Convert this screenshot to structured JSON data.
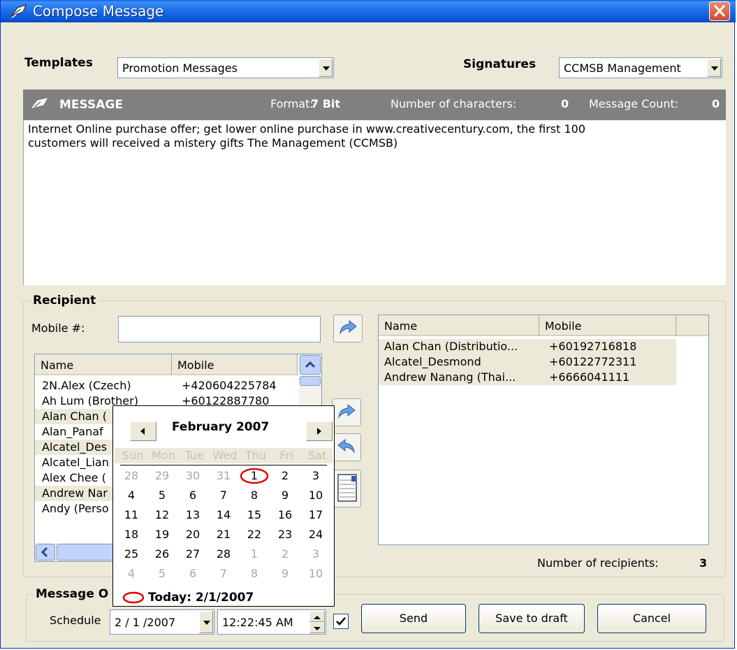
{
  "window": {
    "title": "Compose Message"
  },
  "templates": {
    "label": "Templates",
    "value": "Promotion Messages"
  },
  "signatures": {
    "label": "Signatures",
    "value": "CCMSB Management"
  },
  "message": {
    "header_label": "MESSAGE",
    "format_label": "Format:",
    "format_value": "7 Bit",
    "chars_label": "Number of characters:",
    "chars_value": "0",
    "count_label": "Message Count:",
    "count_value": "0",
    "body_line1": "Internet Online purchase offer; get lower online purchase in www.creativecentury.com, the first 100",
    "body_line2": "customers will received a mistery gifts The Management (CCMSB)"
  },
  "recipient": {
    "group_label": "Recipient",
    "mobile_label": "Mobile #:",
    "mobile_value": "",
    "contacts_headers": [
      "Name",
      "Mobile"
    ],
    "contacts": [
      {
        "name": "2N.Alex (Czech)",
        "mobile": "+420604225784"
      },
      {
        "name": "Ah Lum (Brother)",
        "mobile": "+60122887780"
      },
      {
        "name": "Alan Chan (",
        "mobile": ""
      },
      {
        "name": "Alan_Panaf",
        "mobile": ""
      },
      {
        "name": "Alcatel_Des",
        "mobile": ""
      },
      {
        "name": "Alcatel_Lian",
        "mobile": ""
      },
      {
        "name": "Alex Chee (",
        "mobile": ""
      },
      {
        "name": "Andrew Nar",
        "mobile": ""
      },
      {
        "name": "Andy (Perso",
        "mobile": ""
      }
    ],
    "selected_headers": [
      "Name",
      "Mobile"
    ],
    "selected": [
      {
        "name": "Alan Chan (Distributio...",
        "mobile": "+60192716818"
      },
      {
        "name": "Alcatel_Desmond",
        "mobile": "+60122772311"
      },
      {
        "name": "Andrew Nanang (Thai...",
        "mobile": "+6666041111"
      }
    ],
    "count_label": "Number of recipients:",
    "count_value": "3"
  },
  "calendar": {
    "month_label": "February 2007",
    "day_names": [
      "Sun",
      "Mon",
      "Tue",
      "Wed",
      "Thu",
      "Fri",
      "Sat"
    ],
    "weeks": [
      [
        "28",
        "29",
        "30",
        "31",
        "1",
        "2",
        "3"
      ],
      [
        "4",
        "5",
        "6",
        "7",
        "8",
        "9",
        "10"
      ],
      [
        "11",
        "12",
        "13",
        "14",
        "15",
        "16",
        "17"
      ],
      [
        "18",
        "19",
        "20",
        "21",
        "22",
        "23",
        "24"
      ],
      [
        "25",
        "26",
        "27",
        "28",
        "1",
        "2",
        "3"
      ],
      [
        "4",
        "5",
        "6",
        "7",
        "8",
        "9",
        "10"
      ]
    ],
    "today_label": "Today: 2/1/2007"
  },
  "options": {
    "group_label": "Message O",
    "schedule_label": "Schedule",
    "date_value": "2 / 1 /2007",
    "time_value": "12:22:45 AM",
    "send_label": "Send",
    "draft_label": "Save to draft",
    "cancel_label": "Cancel"
  },
  "colors": {
    "titlebar": "#0a57d8",
    "message_header": "#808080",
    "window_bg": "#ece9d8",
    "selection": "#ece9d8"
  }
}
